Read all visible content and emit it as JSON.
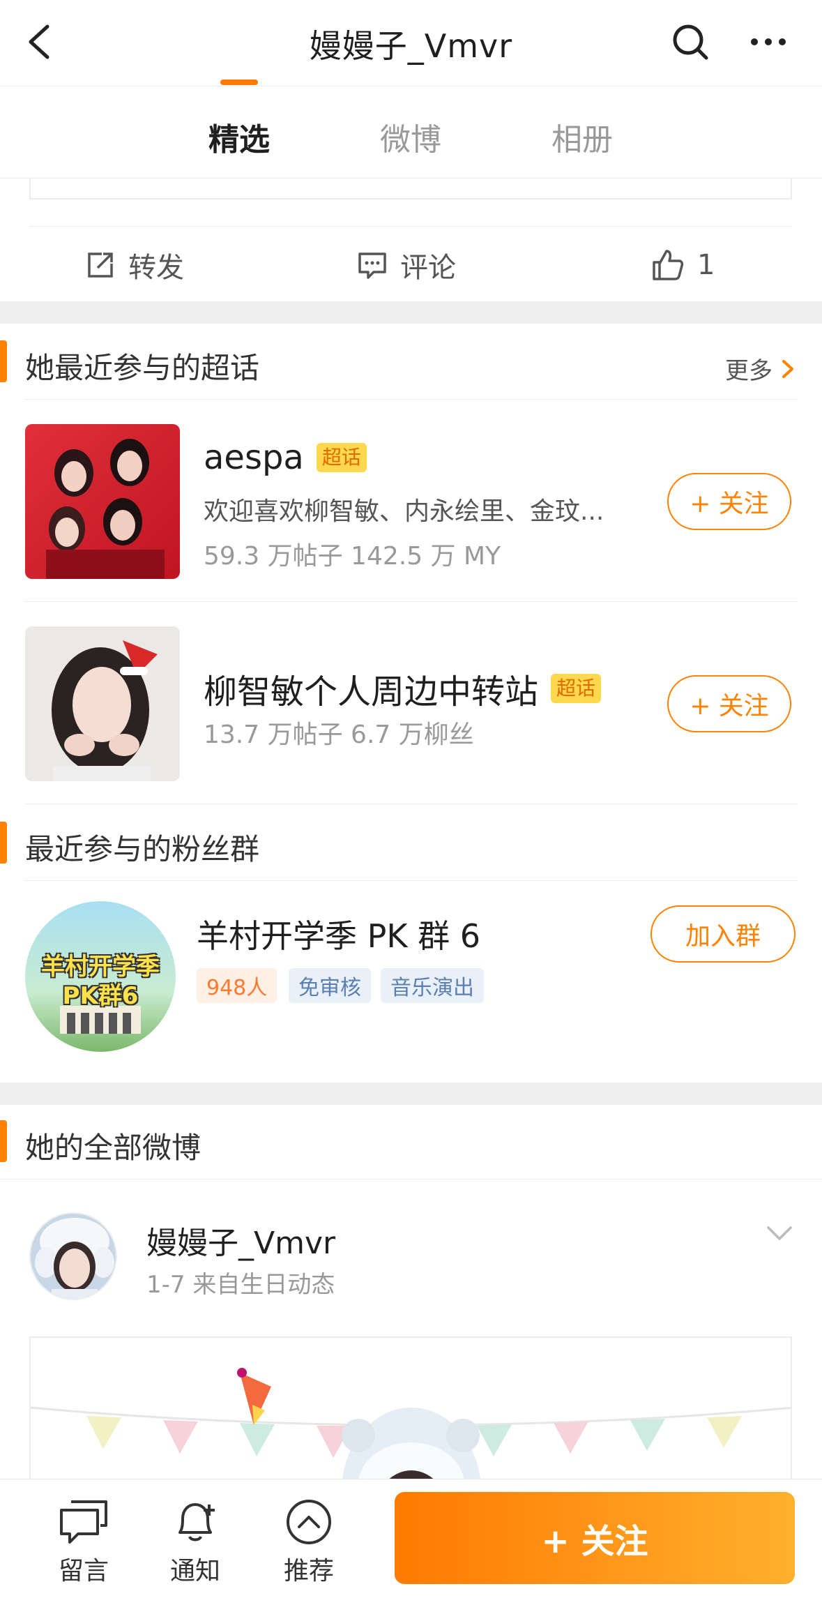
{
  "header": {
    "title": "嫚嫚子_Vmvr",
    "icons": {
      "back": "back-arrow-icon",
      "search": "search-icon",
      "more": "more-dots-icon"
    }
  },
  "tabs": [
    {
      "label": "精选",
      "active": true
    },
    {
      "label": "微博",
      "active": false
    },
    {
      "label": "相册",
      "active": false
    }
  ],
  "prev_post_actions": {
    "repost_label": "转发",
    "comment_label": "评论",
    "like_count": "1"
  },
  "super_topics": {
    "title": "她最近参与的超话",
    "more_label": "更多",
    "items": [
      {
        "name": "aespa",
        "badge": "超话",
        "desc": "欢迎喜欢柳智敏、内永绘里、金玟...",
        "stats": "59.3 万帖子 142.5 万 MY",
        "follow_label": "+ 关注"
      },
      {
        "name": "柳智敏个人周边中转站",
        "badge": "超话",
        "stats": "13.7 万帖子 6.7 万柳丝",
        "follow_label": "+ 关注"
      }
    ]
  },
  "fan_groups": {
    "title": "最近参与的粉丝群",
    "group": {
      "name": "羊村开学季 PK 群 6",
      "avatar_text_1": "羊村开学季",
      "avatar_text_2": "PK群6",
      "tags": [
        "948人",
        "免审核",
        "音乐演出"
      ],
      "join_label": "加入群"
    }
  },
  "all_posts": {
    "title": "她的全部微博",
    "post": {
      "author": "嫚嫚子_Vmvr",
      "meta": "1-7  来自生日动态"
    }
  },
  "bottom_bar": {
    "message_label": "留言",
    "notify_label": "通知",
    "recommend_label": "推荐",
    "follow_label": "+ 关注"
  },
  "colors": {
    "accent": "#ff8200",
    "badge_bg": "#ffd84d",
    "tag_people_bg": "#fff0e6",
    "tag_blue_bg": "#eaf0f8",
    "tag_blue_text": "#5b7fb0"
  }
}
